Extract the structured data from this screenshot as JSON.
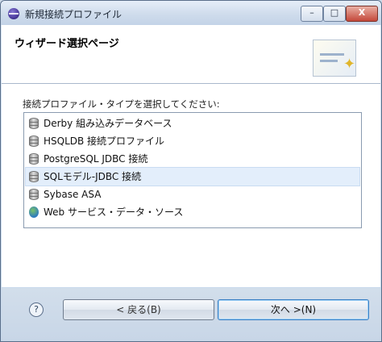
{
  "window": {
    "title": "新規接続プロファイル",
    "controls": {
      "minimize": "–",
      "maximize": "□",
      "close": "X"
    }
  },
  "header": {
    "title": "ウィザード選択ページ",
    "icon": "wizard-graphic"
  },
  "connection_list": {
    "label": "接続プロファイル・タイプを選択してください:",
    "items": [
      {
        "label": "Derby 組み込みデータベース",
        "icon": "database-icon"
      },
      {
        "label": "HSQLDB 接続プロファイル",
        "icon": "database-icon"
      },
      {
        "label": "PostgreSQL JDBC 接続",
        "icon": "database-icon"
      },
      {
        "label": "SQLモデル-JDBC 接続",
        "icon": "database-icon",
        "selected": true
      },
      {
        "label": "Sybase ASA",
        "icon": "database-icon"
      },
      {
        "label": "Web サービス・データ・ソース",
        "icon": "web-service-icon"
      }
    ]
  },
  "footer": {
    "help": "?",
    "back_label": "< 戻る(B)",
    "next_label": "次へ >(N)"
  },
  "colors": {
    "selection": "#e3eefb",
    "default_button_border": "#3b7fc4"
  }
}
